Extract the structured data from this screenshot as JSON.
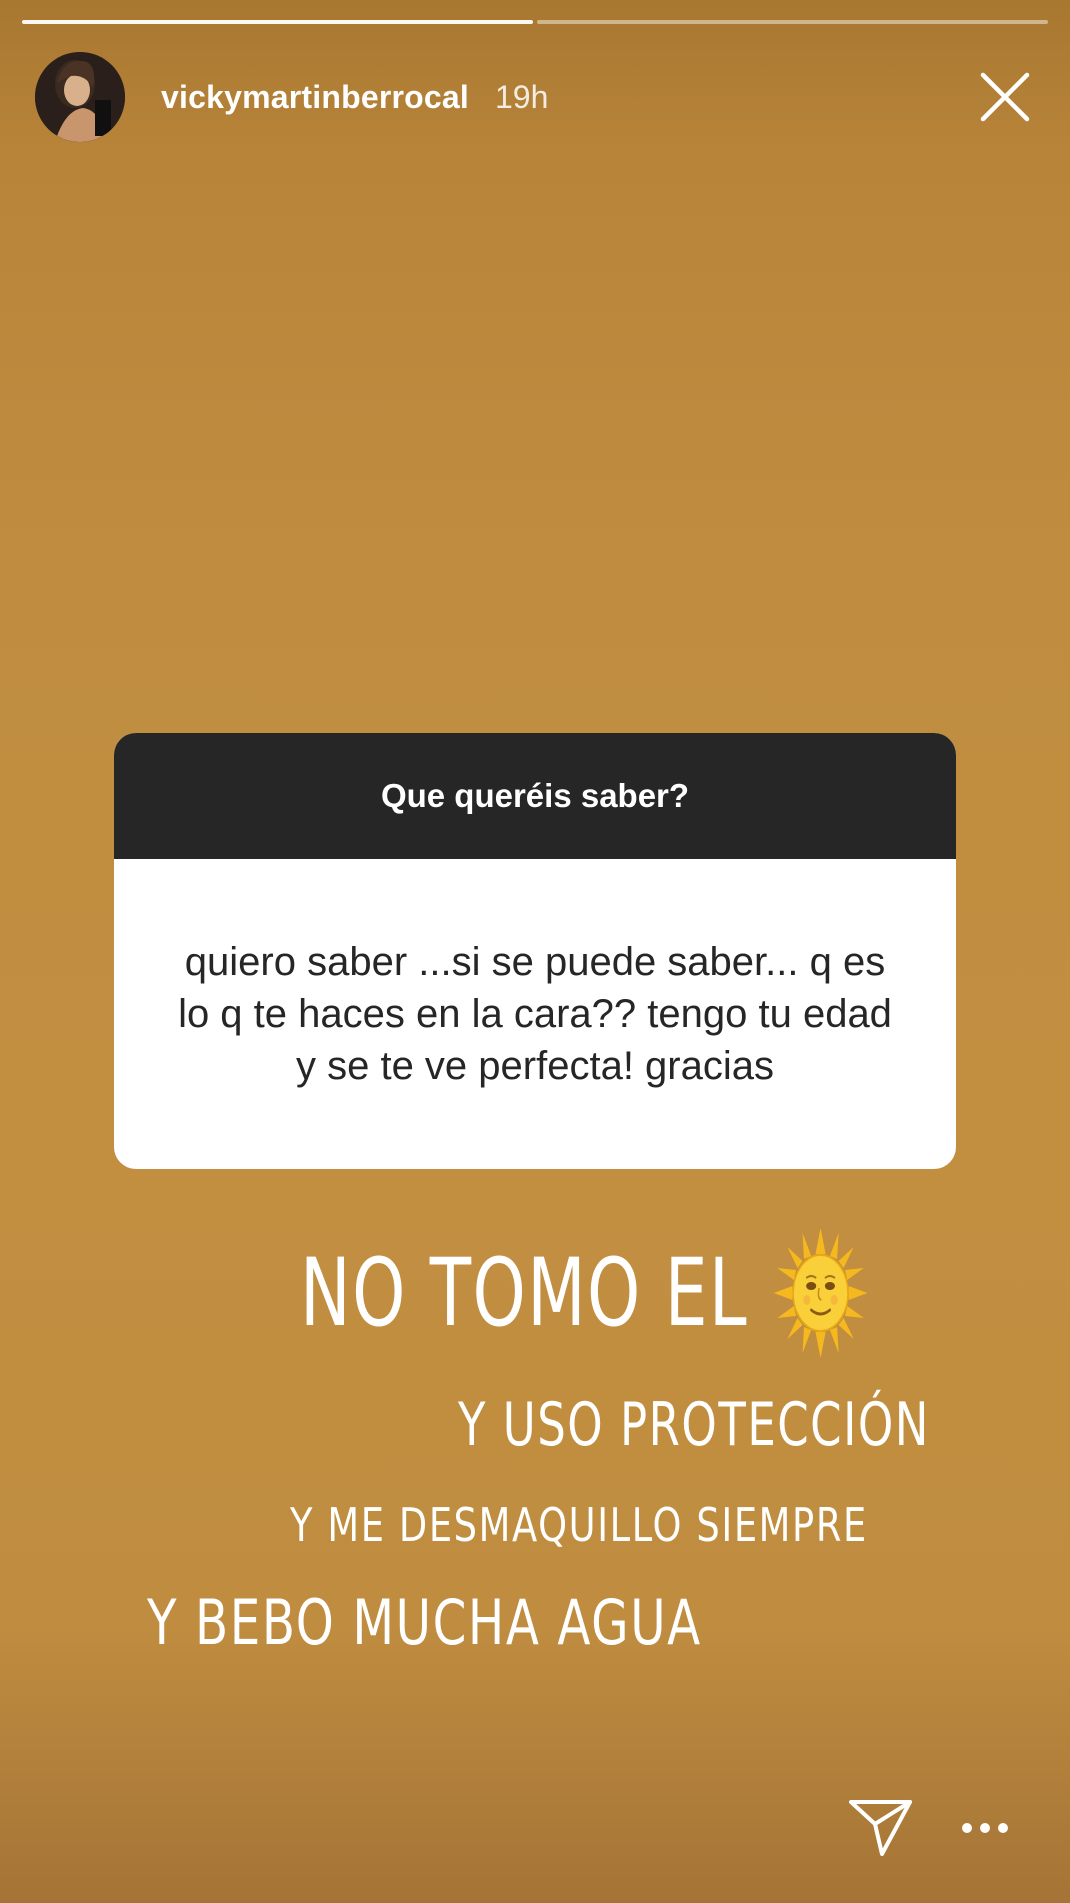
{
  "story": {
    "segments_total": 2,
    "segments_done": 1,
    "username": "vickymartinberrocal",
    "timestamp": "19h"
  },
  "question_card": {
    "prompt": "Que queréis saber?",
    "question": "quiero saber ...si se puede saber... q es lo q te haces en la cara?? tengo tu edad y se te ve perfecta! gracias"
  },
  "answer": {
    "line1": "NO TOMO EL",
    "line1_emoji": "sun-with-face-icon",
    "line2": "Y USO PROTECCIÓN",
    "line3": "Y ME DESMAQUILLO SIEMPRE",
    "line4": "Y BEBO MUCHA AGUA"
  },
  "icons": {
    "close": "close-icon",
    "send": "send-icon",
    "more": "more-icon"
  },
  "colors": {
    "background": "#c08d40",
    "card_header": "#262626",
    "card_body": "#ffffff",
    "text_light": "#ffffff",
    "sun": "#f7c325"
  }
}
